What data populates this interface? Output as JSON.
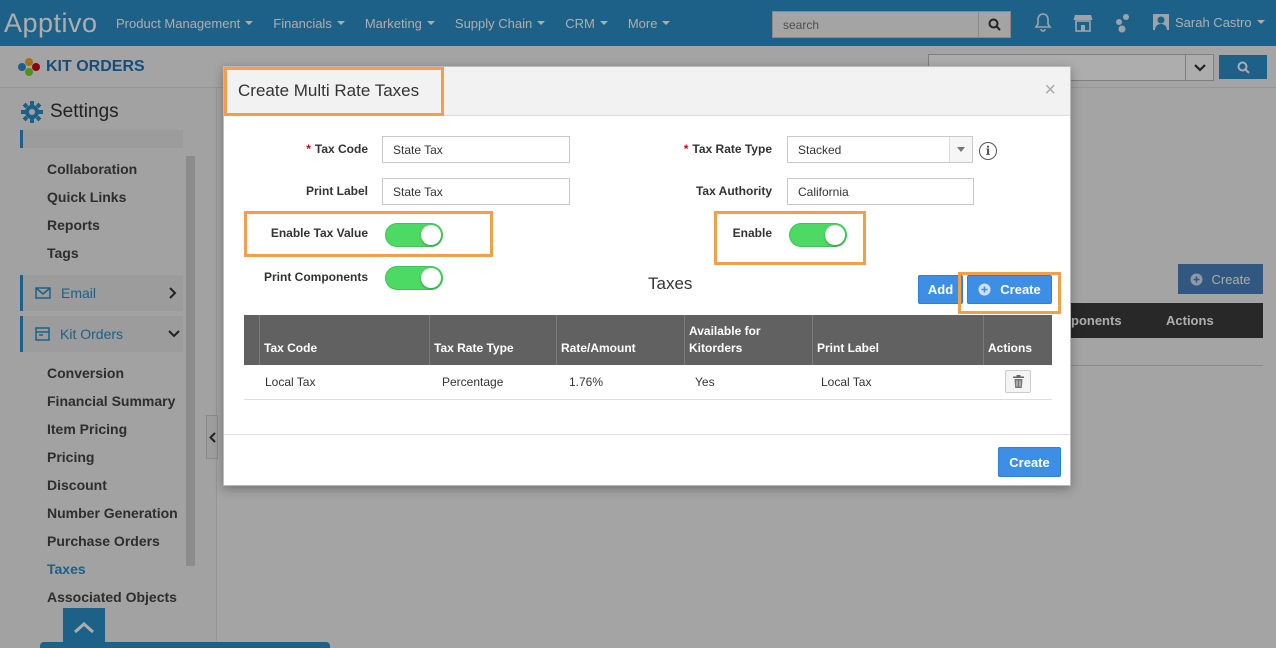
{
  "app": {
    "logo": "Apptivo"
  },
  "nav": {
    "items": [
      "Product Management",
      "Financials",
      "Marketing",
      "Supply Chain",
      "CRM",
      "More"
    ],
    "search_placeholder": "search",
    "user_name": "Sarah Castro"
  },
  "subheader": {
    "app_title": "KIT ORDERS"
  },
  "sidebar": {
    "title": "Settings",
    "items_top": [
      "Collaboration",
      "Quick Links",
      "Reports",
      "Tags"
    ],
    "groups": {
      "email": "Email",
      "kit_orders": "Kit Orders"
    },
    "items_kit": [
      "Conversion",
      "Financial Summary",
      "Item Pricing",
      "Pricing",
      "Discount",
      "Number Generation",
      "Purchase Orders",
      "Taxes",
      "Associated Objects"
    ],
    "active_item": "Taxes"
  },
  "background": {
    "create_label": "Create",
    "col_components_partial": "ponents",
    "col_actions": "Actions"
  },
  "modal": {
    "title": "Create Multi Rate Taxes",
    "close": "×",
    "fields": {
      "tax_code_label": "Tax Code",
      "tax_code_value": "State Tax",
      "print_label_label": "Print Label",
      "print_label_value": "State Tax",
      "tax_rate_type_label": "Tax Rate Type",
      "tax_rate_type_value": "Stacked",
      "tax_authority_label": "Tax Authority",
      "tax_authority_value": "California",
      "enable_tax_value_label": "Enable Tax Value",
      "enable_label": "Enable",
      "print_components_label": "Print Components"
    },
    "toggles": {
      "enable_tax_value": true,
      "enable": true,
      "print_components": true
    },
    "taxes_title": "Taxes",
    "add_button": "Add",
    "create_inline_button": "Create",
    "table": {
      "headers": [
        "Tax Code",
        "Tax Rate Type",
        "Rate/Amount",
        "Available for Kitorders",
        "Print Label",
        "Actions"
      ],
      "header_available_line1": "Available for",
      "header_available_line2": "Kitorders",
      "rows": [
        {
          "tax_code": "Local Tax",
          "tax_rate_type": "Percentage",
          "rate": "1.76%",
          "available": "Yes",
          "print_label": "Local Tax"
        }
      ]
    },
    "footer_create_button": "Create"
  },
  "colors": {
    "brand_blue": "#2b8fc9",
    "highlight": "#f0a04b",
    "toggle_on": "#4cd964",
    "button_blue": "#3d8fe6"
  }
}
